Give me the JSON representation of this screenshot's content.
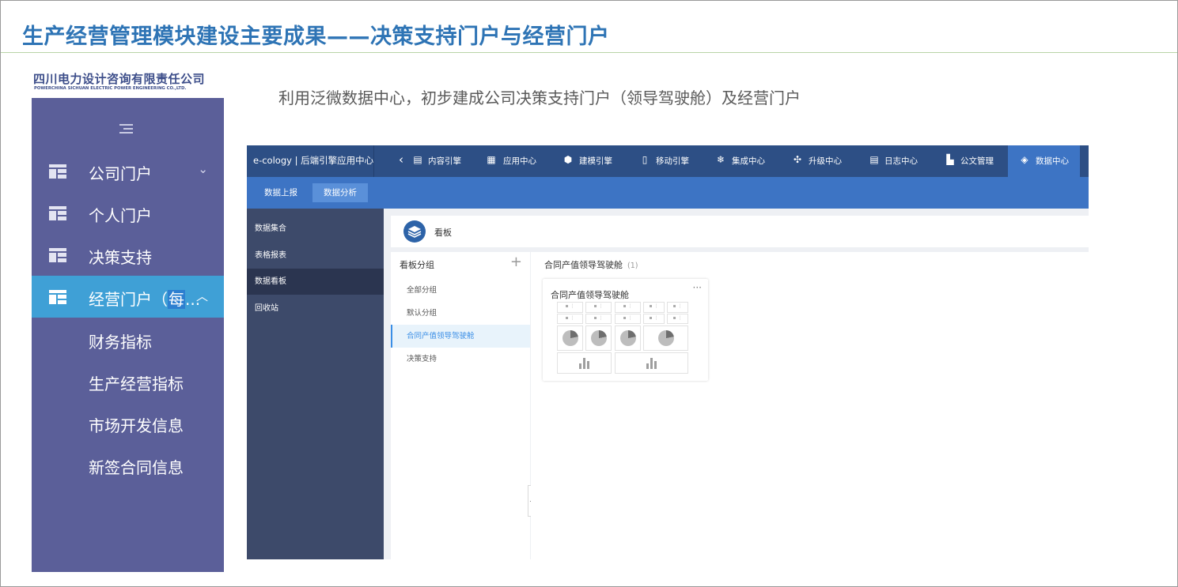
{
  "slide": {
    "title": "生产经营管理模块建设主要成果——决策支持门户与经营门户",
    "intro": "利用泛微数据中心，初步建成公司决策支持门户（领导驾驶舱）及经营门户"
  },
  "left_menu": {
    "logo_cn": "四川电力设计咨询有限责任公司",
    "logo_en": "POWERCHINA SICHUAN ELECTRIC POWER ENGINEERING CO.,LTD.",
    "items": [
      {
        "label": "公司门户"
      },
      {
        "label": "个人门户"
      },
      {
        "label": "决策支持"
      },
      {
        "label": "经营门户（",
        "label_highlight": "每",
        "label_tail": "..."
      }
    ],
    "sub_items": [
      "财务指标",
      "生产经营指标",
      "市场开发信息",
      "新签合同信息"
    ],
    "colors": {
      "bg": "#5b5f99",
      "active": "#3fa0d6"
    }
  },
  "app": {
    "brand": "e-cology | 后端引擎应用中心",
    "tabs": [
      {
        "label": "内容引擎",
        "icon": "document-icon"
      },
      {
        "label": "应用中心",
        "icon": "grid-icon"
      },
      {
        "label": "建模引擎",
        "icon": "cube-icon"
      },
      {
        "label": "移动引擎",
        "icon": "mobile-icon"
      },
      {
        "label": "集成中心",
        "icon": "snowflake-icon"
      },
      {
        "label": "升级中心",
        "icon": "refresh-icon"
      },
      {
        "label": "日志中心",
        "icon": "log-icon"
      },
      {
        "label": "公文管理",
        "icon": "file-icon"
      },
      {
        "label": "数据中心",
        "icon": "layers-icon",
        "active": true
      }
    ],
    "sub_tabs": [
      {
        "label": "数据上报"
      },
      {
        "label": "数据分析",
        "active": true
      }
    ],
    "sidebar": [
      "数据集合",
      "表格报表",
      "数据看板",
      "回收站"
    ],
    "sidebar_active": "数据看板",
    "kanban_title": "看板",
    "group_panel": {
      "title": "看板分组",
      "plus": "+",
      "items": [
        "全部分组",
        "默认分组",
        "合同产值领导驾驶舱",
        "决策支持"
      ],
      "active": "合同产值领导驾驶舱"
    },
    "content": {
      "title": "合同产值领导驾驶舱",
      "count": "(1)",
      "card_title": "合同产值领导驾驶舱",
      "card_more": "···"
    },
    "colors": {
      "topbar": "#2d4f85",
      "accent": "#3d74c4",
      "sidebar": "#3d4a6a"
    }
  }
}
